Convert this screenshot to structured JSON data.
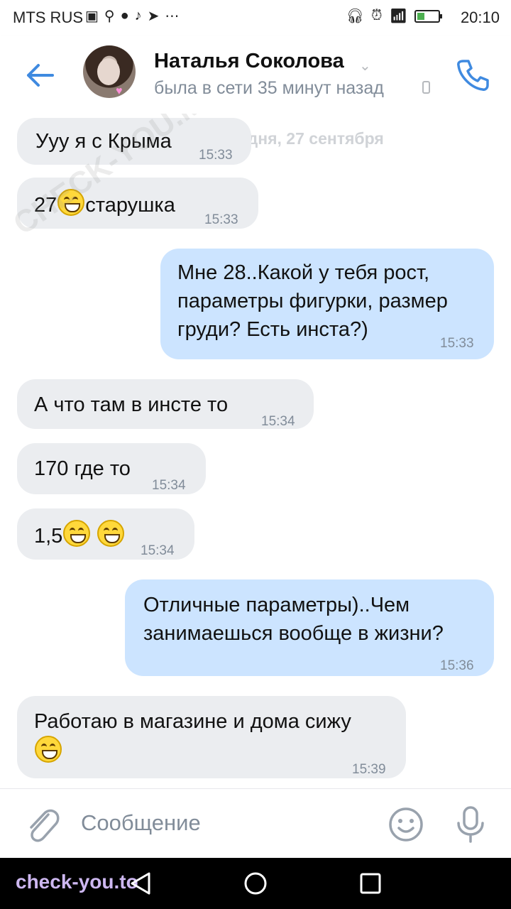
{
  "status_bar": {
    "carrier": "MTS RUS",
    "time": "20:10",
    "left_icons": [
      "sim-icon",
      "search-icon",
      "chat-icon",
      "tiktok-icon",
      "telegram-icon",
      "more-icon"
    ],
    "right_icons": [
      "headphones-icon",
      "alarm-icon",
      "signal-icon",
      "battery-icon"
    ],
    "battery_level": 0.35
  },
  "header": {
    "contact_name": "Наталья Соколова",
    "last_seen": "была в сети 35 минут назад",
    "accent_color": "#3f8ae0"
  },
  "chat": {
    "date_separator": "сегодня, 27 сентября",
    "messages": [
      {
        "dir": "in",
        "text": "Ууу я с Крыма",
        "time": "15:33"
      },
      {
        "dir": "in",
        "text_before": "27",
        "text_after": "старушка",
        "time": "15:33"
      },
      {
        "dir": "out",
        "lines": [
          "Мне 28..Какой у тебя рост,",
          "параметры фигурки, размер",
          "груди? Есть инста?)"
        ],
        "time": "15:33"
      },
      {
        "dir": "in",
        "text": "А что там в инсте то",
        "time": "15:34"
      },
      {
        "dir": "in",
        "text": "170 где то",
        "time": "15:34"
      },
      {
        "dir": "in",
        "text": "1,5",
        "time": "15:34"
      },
      {
        "dir": "out",
        "lines": [
          "Отличные параметры)..Чем",
          "занимаешься вообще в жизни?"
        ],
        "time": "15:36"
      },
      {
        "dir": "in",
        "text": "Работаю в магазине и дома сижу",
        "time": "15:39"
      }
    ]
  },
  "input": {
    "placeholder": "Сообщение"
  },
  "watermarks": {
    "top": "CHECK-YOU.ME",
    "bottom": "check-you.to"
  }
}
